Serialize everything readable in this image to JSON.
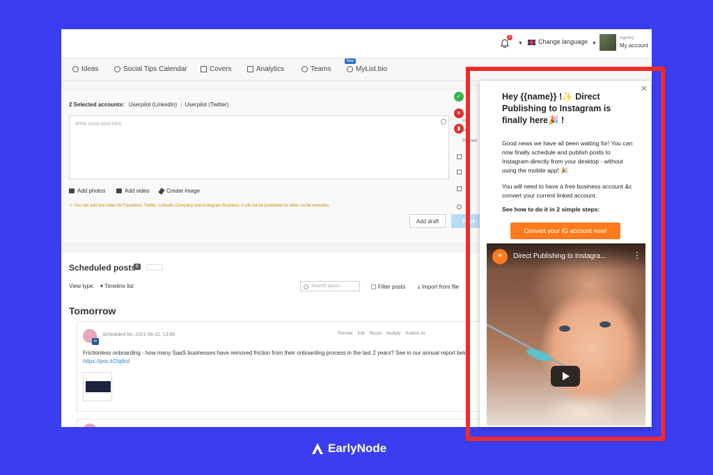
{
  "topbar": {
    "notification_count": "2",
    "change_language": "Change language",
    "account_role": "Agency",
    "account_name": "My account"
  },
  "nav": {
    "items": [
      {
        "label": "Ideas",
        "icon": "lightbulb-icon"
      },
      {
        "label": "Social Tips Calendar",
        "icon": "compass-icon"
      },
      {
        "label": "Covers",
        "icon": "image-icon"
      },
      {
        "label": "Analytics",
        "icon": "bar-chart-icon"
      },
      {
        "label": "Teams",
        "icon": "users-icon"
      },
      {
        "label": "MyList.bio",
        "icon": "link-icon"
      }
    ],
    "new_badge": "New"
  },
  "composer": {
    "selected_label": "2 Selected accounts:",
    "account_1": "Userpilot (LinkedIn)",
    "account_2": "Userpilot (Twitter)",
    "post_placeholder": "Write some post here",
    "add_photos": "Add photos",
    "add_video": "Add video",
    "create_image": "Create image",
    "warning": "You can add one video for Facebook, Twitter, LinkedIn Company and Instagram Business, it will not be published for other social networks.",
    "add_draft": "Add draft",
    "publish": "Publi",
    "side_text_1": "ing",
    "side_text_2": "era",
    "side_text_3": "Preview"
  },
  "scheduled": {
    "title": "Scheduled posts",
    "count": "8",
    "view_type_label": "View type:",
    "view_type_value": "Timeline list",
    "search_placeholder": "Search posts...",
    "filter_posts": "Filter posts",
    "import_from_file": "Import from file",
    "day_heading": "Tomorrow",
    "post": {
      "scheduled_for": "Scheduled for: 2021-06-22, 13:58",
      "actions": [
        "Preview",
        "Edit",
        "Reuse",
        "Multiply",
        "Publish no"
      ],
      "text": "Frictionless onboarding - how many SaaS businesses have removed friction from their onboarding process in the last 2 years? See in our annual report belo",
      "link": "https://pos.li/2iq6rd"
    }
  },
  "modal": {
    "close": "×",
    "title": "Hey {{name}} !✨  Direct Publishing to Instagram is finally here🎉 !",
    "para1": "Good news we have all been waiting for! You can now finally schedule and publish posts to Instagram directly from your desktop - without using the mobile app! 🎉",
    "para2": "You will need to have a free business account &c convert your current linked account.",
    "para3": "See how to do it in 2 simple steps:",
    "cta": "Convert your IG account now!",
    "video_title": "Direct Publishing to Instagra..."
  },
  "brand": {
    "name": "EarlyNode"
  },
  "colors": {
    "background": "#3b3ef0",
    "highlight": "#f22a2a",
    "cta": "#ff7a1a"
  }
}
